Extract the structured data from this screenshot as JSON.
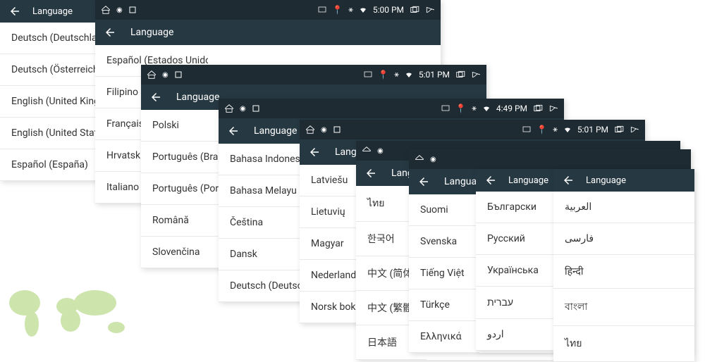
{
  "label_language": "Language",
  "panels": {
    "p0": {
      "items": [
        "Deutsch (Deutschland)",
        "Deutsch (Österreich)",
        "English (United Kingdom)",
        "English (United States)",
        "Español (España)"
      ]
    },
    "p1": {
      "time": "5:00 PM",
      "items": [
        "Español (Estados Unidos)",
        "Filipino",
        "Français",
        "Hrvatski",
        "Italiano"
      ]
    },
    "p2": {
      "time": "5:01 PM",
      "items": [
        "Polski",
        "Português (Brasil)",
        "Português (Portugal)",
        "Română",
        "Slovenčina"
      ]
    },
    "p3": {
      "time": "4:49 PM",
      "items": [
        "Bahasa Indonesia",
        "Bahasa Melayu",
        "Čeština",
        "Dansk",
        "Deutsch (Deutschland)"
      ]
    },
    "p4": {
      "time": "5:01 PM",
      "items": [
        "Latviešu",
        "Lietuvių",
        "Magyar",
        "Nederlands",
        "Norsk bokmål"
      ]
    },
    "p5": {
      "items": [
        "ไทย",
        "한국어",
        "中文 (简体)",
        "中文 (繁體)",
        "日本語"
      ]
    },
    "p6": {
      "items": [
        "Suomi",
        "Svenska",
        "Tiếng Việt",
        "Türkçe",
        "Ελληνικά"
      ]
    },
    "p7": {
      "items": [
        "Български",
        "Русский",
        "Українська",
        "עברית",
        "اردو"
      ]
    },
    "p8": {
      "items": [
        "العربية",
        "فارسی",
        "हिन्दी",
        "বাংলা",
        "ไทย"
      ]
    }
  }
}
